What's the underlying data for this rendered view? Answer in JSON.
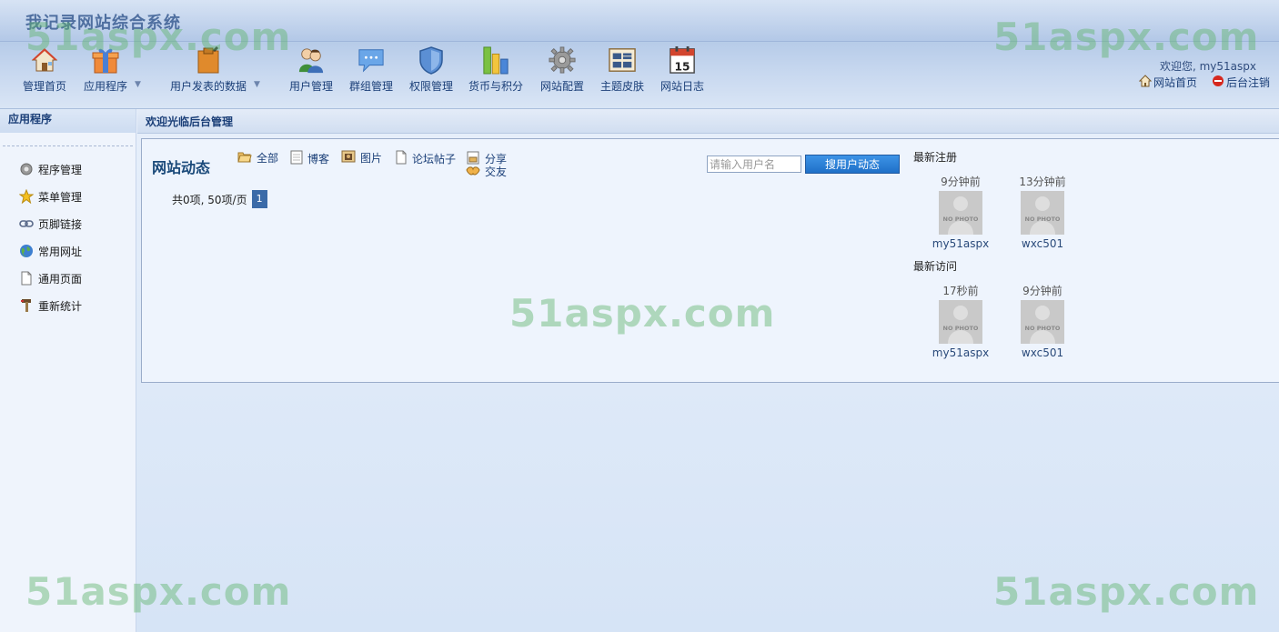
{
  "header": {
    "title": "我记录网站综合系统",
    "welcome": "欢迎您, my51aspx",
    "links": [
      {
        "label": "网站首页",
        "icon": "home-icon"
      },
      {
        "label": "后台注销",
        "icon": "logout-icon"
      }
    ]
  },
  "nav": [
    {
      "label": "管理首页",
      "icon": "house-icon"
    },
    {
      "label": "应用程序",
      "icon": "gift-icon",
      "dropdown": true
    },
    {
      "label": "用户发表的数据",
      "icon": "clipboard-icon",
      "dropdown": true
    },
    {
      "label": "用户管理",
      "icon": "users-icon"
    },
    {
      "label": "群组管理",
      "icon": "chat-bubble-icon"
    },
    {
      "label": "权限管理",
      "icon": "shield-icon"
    },
    {
      "label": "货币与积分",
      "icon": "bar-chart-icon"
    },
    {
      "label": "网站配置",
      "icon": "gear-icon"
    },
    {
      "label": "主题皮肤",
      "icon": "theme-icon"
    },
    {
      "label": "网站日志",
      "icon": "calendar-icon"
    }
  ],
  "calendar_icon_day": "15",
  "sidebar": {
    "title": "应用程序",
    "items": [
      {
        "label": "程序管理",
        "icon": "gear-icon"
      },
      {
        "label": "菜单管理",
        "icon": "star-icon"
      },
      {
        "label": "页脚链接",
        "icon": "link-icon"
      },
      {
        "label": "常用网址",
        "icon": "globe-icon"
      },
      {
        "label": "通用页面",
        "icon": "page-icon"
      },
      {
        "label": "重新统计",
        "icon": "tools-icon"
      }
    ]
  },
  "main": {
    "heading": "欢迎光临后台管理",
    "feed": {
      "title": "网站动态",
      "filters": [
        {
          "label": "全部",
          "icon": "folder-icon"
        },
        {
          "label": "博客",
          "icon": "blog-icon"
        },
        {
          "label": "图片",
          "icon": "photo-icon"
        },
        {
          "label": "论坛帖子",
          "icon": "document-icon"
        },
        {
          "label": "分享",
          "icon": "share-icon"
        },
        {
          "label": "交友",
          "icon": "handshake-icon"
        }
      ],
      "pager_text": "共0项, 50项/页",
      "current_page": "1",
      "search_placeholder": "请输入用户名",
      "search_button": "搜用户动态"
    },
    "latest_registered": {
      "title": "最新注册",
      "users": [
        {
          "time": "9分钟前",
          "name": "my51aspx"
        },
        {
          "time": "13分钟前",
          "name": "wxc501"
        }
      ]
    },
    "latest_visits": {
      "title": "最新访问",
      "users": [
        {
          "time": "17秒前",
          "name": "my51aspx"
        },
        {
          "time": "9分钟前",
          "name": "wxc501"
        }
      ]
    },
    "nophoto_text": "NO PHOTO"
  },
  "watermark": "51aspx.com"
}
